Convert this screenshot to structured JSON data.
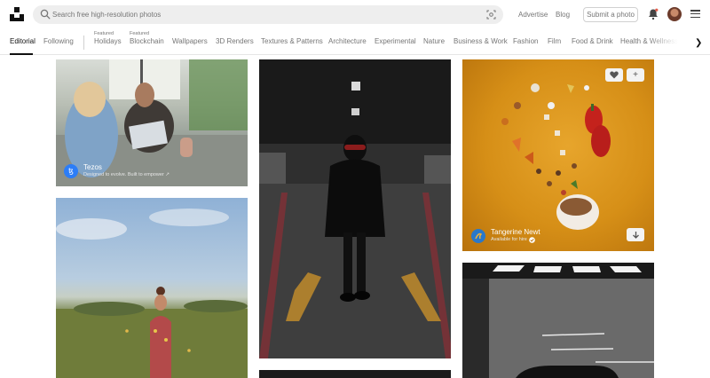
{
  "header": {
    "search_placeholder": "Search free high-resolution photos",
    "links": [
      "Advertise",
      "Blog"
    ],
    "submit_label": "Submit a photo"
  },
  "topics": {
    "items": [
      {
        "label": "Editorial",
        "featured": ""
      },
      {
        "label": "Following",
        "featured": ""
      },
      {
        "label": "Holidays",
        "featured": "Featured"
      },
      {
        "label": "Blockchain",
        "featured": "Featured"
      },
      {
        "label": "Wallpapers",
        "featured": ""
      },
      {
        "label": "3D Renders",
        "featured": ""
      },
      {
        "label": "Textures & Patterns",
        "featured": ""
      },
      {
        "label": "Architecture",
        "featured": ""
      },
      {
        "label": "Experimental",
        "featured": ""
      },
      {
        "label": "Nature",
        "featured": ""
      },
      {
        "label": "Business & Work",
        "featured": ""
      },
      {
        "label": "Fashion",
        "featured": ""
      },
      {
        "label": "Film",
        "featured": ""
      },
      {
        "label": "Food & Drink",
        "featured": ""
      },
      {
        "label": "Health & Wellness",
        "featured": ""
      }
    ],
    "active": "Editorial"
  },
  "photos": {
    "sponsor": {
      "name": "Tezos",
      "tagline": "Designed to evolve. Built to empower ↗",
      "avatar_glyph": "ꜩ"
    },
    "author": {
      "name": "Tangerine Newt",
      "status": "Available for hire"
    }
  },
  "colors": {
    "accent": "#111111",
    "muted": "#767676",
    "search_bg": "#eeeeee",
    "tezos_blue": "#2c7df7",
    "hire_badge": "#007fff"
  }
}
